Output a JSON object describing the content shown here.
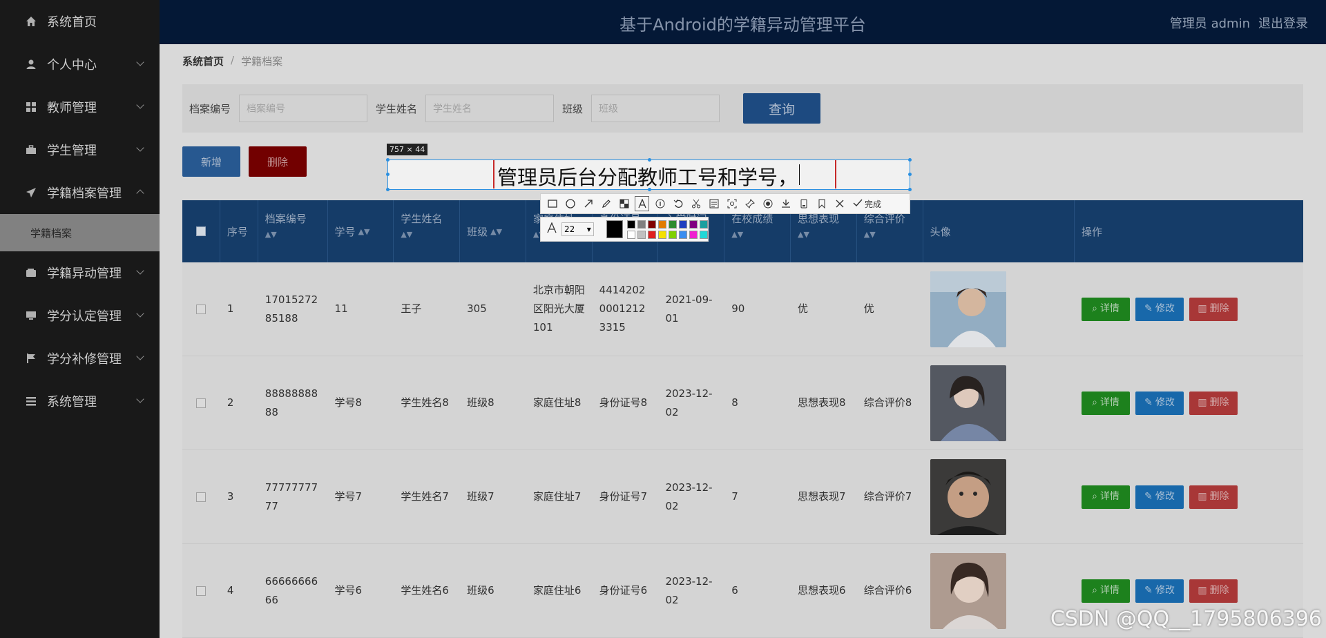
{
  "sidebar": {
    "items": [
      {
        "label": "系统首页",
        "icon": "home-icon"
      },
      {
        "label": "个人中心",
        "icon": "person-icon"
      },
      {
        "label": "教师管理",
        "icon": "grid-icon"
      },
      {
        "label": "学生管理",
        "icon": "briefcase-icon"
      },
      {
        "label": "学籍档案管理",
        "icon": "paper-plane-icon"
      },
      {
        "label": "学籍档案"
      },
      {
        "label": "学籍异动管理",
        "icon": "wallet-icon"
      },
      {
        "label": "学分认定管理",
        "icon": "monitor-icon"
      },
      {
        "label": "学分补修管理",
        "icon": "flag-icon"
      },
      {
        "label": "系统管理",
        "icon": "list-icon"
      }
    ]
  },
  "header": {
    "title": "基于Android的学籍异动管理平台",
    "user": "管理员 admin",
    "logout": "退出登录"
  },
  "breadcrumb": {
    "home": "系统首页",
    "current": "学籍档案"
  },
  "search": {
    "fields": [
      {
        "label": "档案编号",
        "placeholder": "档案编号"
      },
      {
        "label": "学生姓名",
        "placeholder": "学生姓名"
      },
      {
        "label": "班级",
        "placeholder": "班级"
      }
    ],
    "button": "查询"
  },
  "actions": {
    "add": "新增",
    "delete": "删除"
  },
  "table": {
    "headers": [
      "序号",
      "档案编号",
      "学号",
      "学生姓名",
      "班级",
      "家庭住址",
      "身份证号",
      "入学时间",
      "在校成绩",
      "思想表现",
      "综合评价",
      "头像",
      "操作"
    ],
    "rows": [
      {
        "no": "1",
        "archive_no": "1701527285188",
        "student_no": "11",
        "name": "王子",
        "class": "305",
        "address": "北京市朝阳区阳光大厦101",
        "id_no": "441420200012123315",
        "date": "2021-09-01",
        "score": "90",
        "thought": "优",
        "evaluation": "优"
      },
      {
        "no": "2",
        "archive_no": "8888888888",
        "student_no": "学号8",
        "name": "学生姓名8",
        "class": "班级8",
        "address": "家庭住址8",
        "id_no": "身份证号8",
        "date": "2023-12-02",
        "score": "8",
        "thought": "思想表现8",
        "evaluation": "综合评价8"
      },
      {
        "no": "3",
        "archive_no": "7777777777",
        "student_no": "学号7",
        "name": "学生姓名7",
        "class": "班级7",
        "address": "家庭住址7",
        "id_no": "身份证号7",
        "date": "2023-12-02",
        "score": "7",
        "thought": "思想表现7",
        "evaluation": "综合评价7"
      },
      {
        "no": "4",
        "archive_no": "6666666666",
        "student_no": "学号6",
        "name": "学生姓名6",
        "class": "班级6",
        "address": "家庭住址6",
        "id_no": "身份证号6",
        "date": "2023-12-02",
        "score": "6",
        "thought": "思想表现6",
        "evaluation": "综合评价6"
      }
    ],
    "ops": {
      "detail": "详情",
      "edit": "修改",
      "delete": "删除"
    }
  },
  "capture": {
    "size_label": "757 × 44",
    "text": "管理员后台分配教师工号和学号，",
    "font_size": "22",
    "done": "完成",
    "palette": [
      "#000000",
      "#808080",
      "#800000",
      "#e07b00",
      "#2e8b2e",
      "#1f3fbf",
      "#800080",
      "#1b9f9f",
      "#ffffff",
      "#c0c0c0",
      "#e02020",
      "#f5e000",
      "#7fd000",
      "#3a8ef0",
      "#f020d0",
      "#20d8d8"
    ],
    "current_color": "#000000"
  },
  "watermark": "CSDN @QQ__1795806396"
}
